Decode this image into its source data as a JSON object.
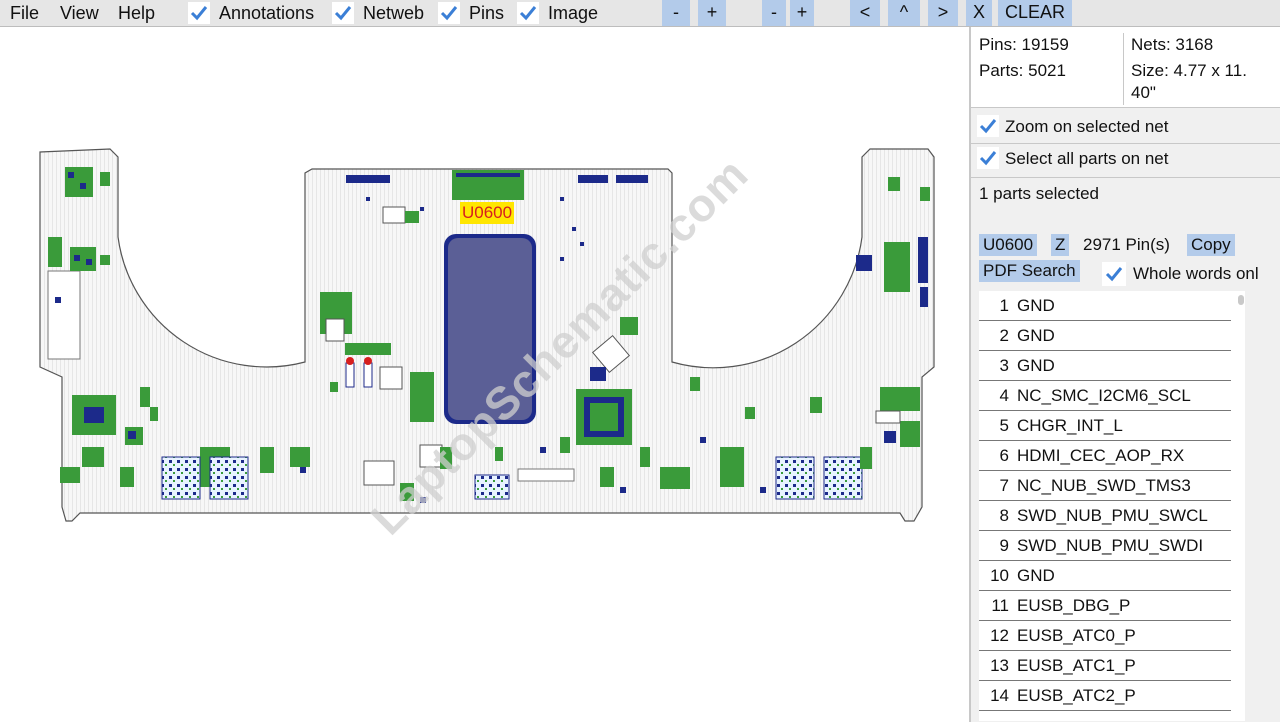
{
  "menu": [
    "File",
    "View",
    "Help"
  ],
  "toggles": [
    {
      "label": "Annotations",
      "checked": true
    },
    {
      "label": "Netweb",
      "checked": true
    },
    {
      "label": "Pins",
      "checked": true
    },
    {
      "label": "Image",
      "checked": true
    }
  ],
  "toolbar": {
    "zoom_out_1": "-",
    "zoom_in_1": "+",
    "zoom_out_2": "-",
    "zoom_in_2": "+",
    "prev": "<",
    "up": "^",
    "next": ">",
    "close": "X",
    "clear": "CLEAR"
  },
  "board": {
    "selected_label": "U0600",
    "watermark": "LaptopSchematic.com"
  },
  "stats": {
    "pins": "Pins: 19159",
    "nets": "Nets: 3168",
    "parts": "Parts: 5021",
    "size_line1": "Size: 4.77 x 11.",
    "size_line2": "40\""
  },
  "options": {
    "zoom_on_net": "Zoom on selected net",
    "select_all_parts": "Select all parts on net"
  },
  "selection": {
    "count_text": "1 parts selected",
    "part": "U0600",
    "z_button": "Z",
    "pin_count": "2971 Pin(s)",
    "copy": "Copy",
    "pdf_search": "PDF Search",
    "whole_words": "Whole words onl"
  },
  "pins": [
    {
      "num": "1",
      "net": "GND"
    },
    {
      "num": "2",
      "net": "GND"
    },
    {
      "num": "3",
      "net": "GND"
    },
    {
      "num": "4",
      "net": "NC_SMC_I2CM6_SCL"
    },
    {
      "num": "5",
      "net": "CHGR_INT_L"
    },
    {
      "num": "6",
      "net": "HDMI_CEC_AOP_RX"
    },
    {
      "num": "7",
      "net": "NC_NUB_SWD_TMS3"
    },
    {
      "num": "8",
      "net": "SWD_NUB_PMU_SWCL"
    },
    {
      "num": "9",
      "net": "SWD_NUB_PMU_SWDI"
    },
    {
      "num": "10",
      "net": "GND"
    },
    {
      "num": "11",
      "net": "EUSB_DBG_P"
    },
    {
      "num": "12",
      "net": "EUSB_ATC0_P"
    },
    {
      "num": "13",
      "net": "EUSB_ATC1_P"
    },
    {
      "num": "14",
      "net": "EUSB_ATC2_P"
    }
  ],
  "colors": {
    "button_bg": "#b3cbea",
    "check_blue": "#3b7fd6",
    "board_outline": "#555555",
    "component_green": "#3a9b3a",
    "pad_blue": "#1c2a8a",
    "chip_fill": "#5b5f96",
    "highlight_yellow": "#ffe600",
    "highlight_text": "#d61f1f"
  }
}
